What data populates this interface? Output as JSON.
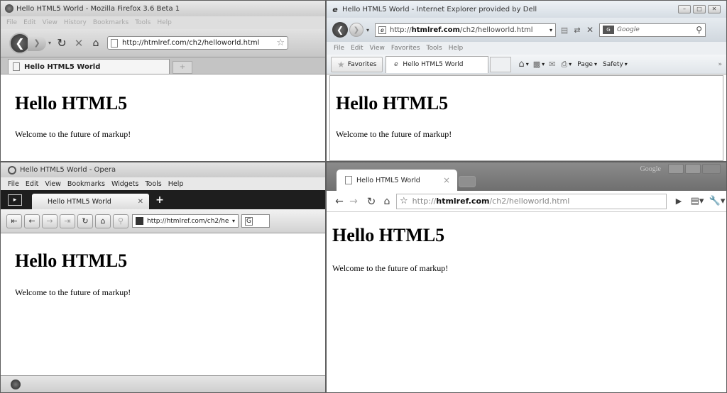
{
  "firefox": {
    "title": "Hello HTML5 World - Mozilla Firefox 3.6 Beta 1",
    "menu": [
      "File",
      "Edit",
      "View",
      "History",
      "Bookmarks",
      "Tools",
      "Help"
    ],
    "url": "http://htmlref.com/ch2/helloworld.html",
    "tab_label": "Hello HTML5 World",
    "new_tab": "+",
    "heading": "Hello HTML5",
    "body": "Welcome to the future of markup!"
  },
  "ie": {
    "title": "Hello HTML5 World - Internet Explorer provided by Dell",
    "url_prefix": "http://",
    "url_domain": "htmlref.com",
    "url_path": "/ch2/helloworld.html",
    "search_placeholder": "Google",
    "menu": [
      "File",
      "Edit",
      "View",
      "Favorites",
      "Tools",
      "Help"
    ],
    "favorites_label": "Favorites",
    "tab_label": "Hello HTML5 World",
    "page_label": "Page",
    "safety_label": "Safety",
    "heading": "Hello HTML5",
    "body": "Welcome to the future of markup!"
  },
  "opera": {
    "title": "Hello HTML5 World - Opera",
    "menu": [
      "File",
      "Edit",
      "View",
      "Bookmarks",
      "Widgets",
      "Tools",
      "Help"
    ],
    "tab_label": "Hello HTML5 World",
    "new_tab": "+",
    "url": "http://htmlref.com/ch2/he",
    "search_letter": "G",
    "heading": "Hello HTML5",
    "body": "Welcome to the future of markup!"
  },
  "chrome": {
    "logo_text": "Google",
    "tab_label": "Hello HTML5 World",
    "tab_close": "×",
    "url_prefix": "http://",
    "url_domain": "htmlref.com",
    "url_path": "/ch2/helloworld.html",
    "heading": "Hello HTML5",
    "body": "Welcome to the future of markup!"
  }
}
